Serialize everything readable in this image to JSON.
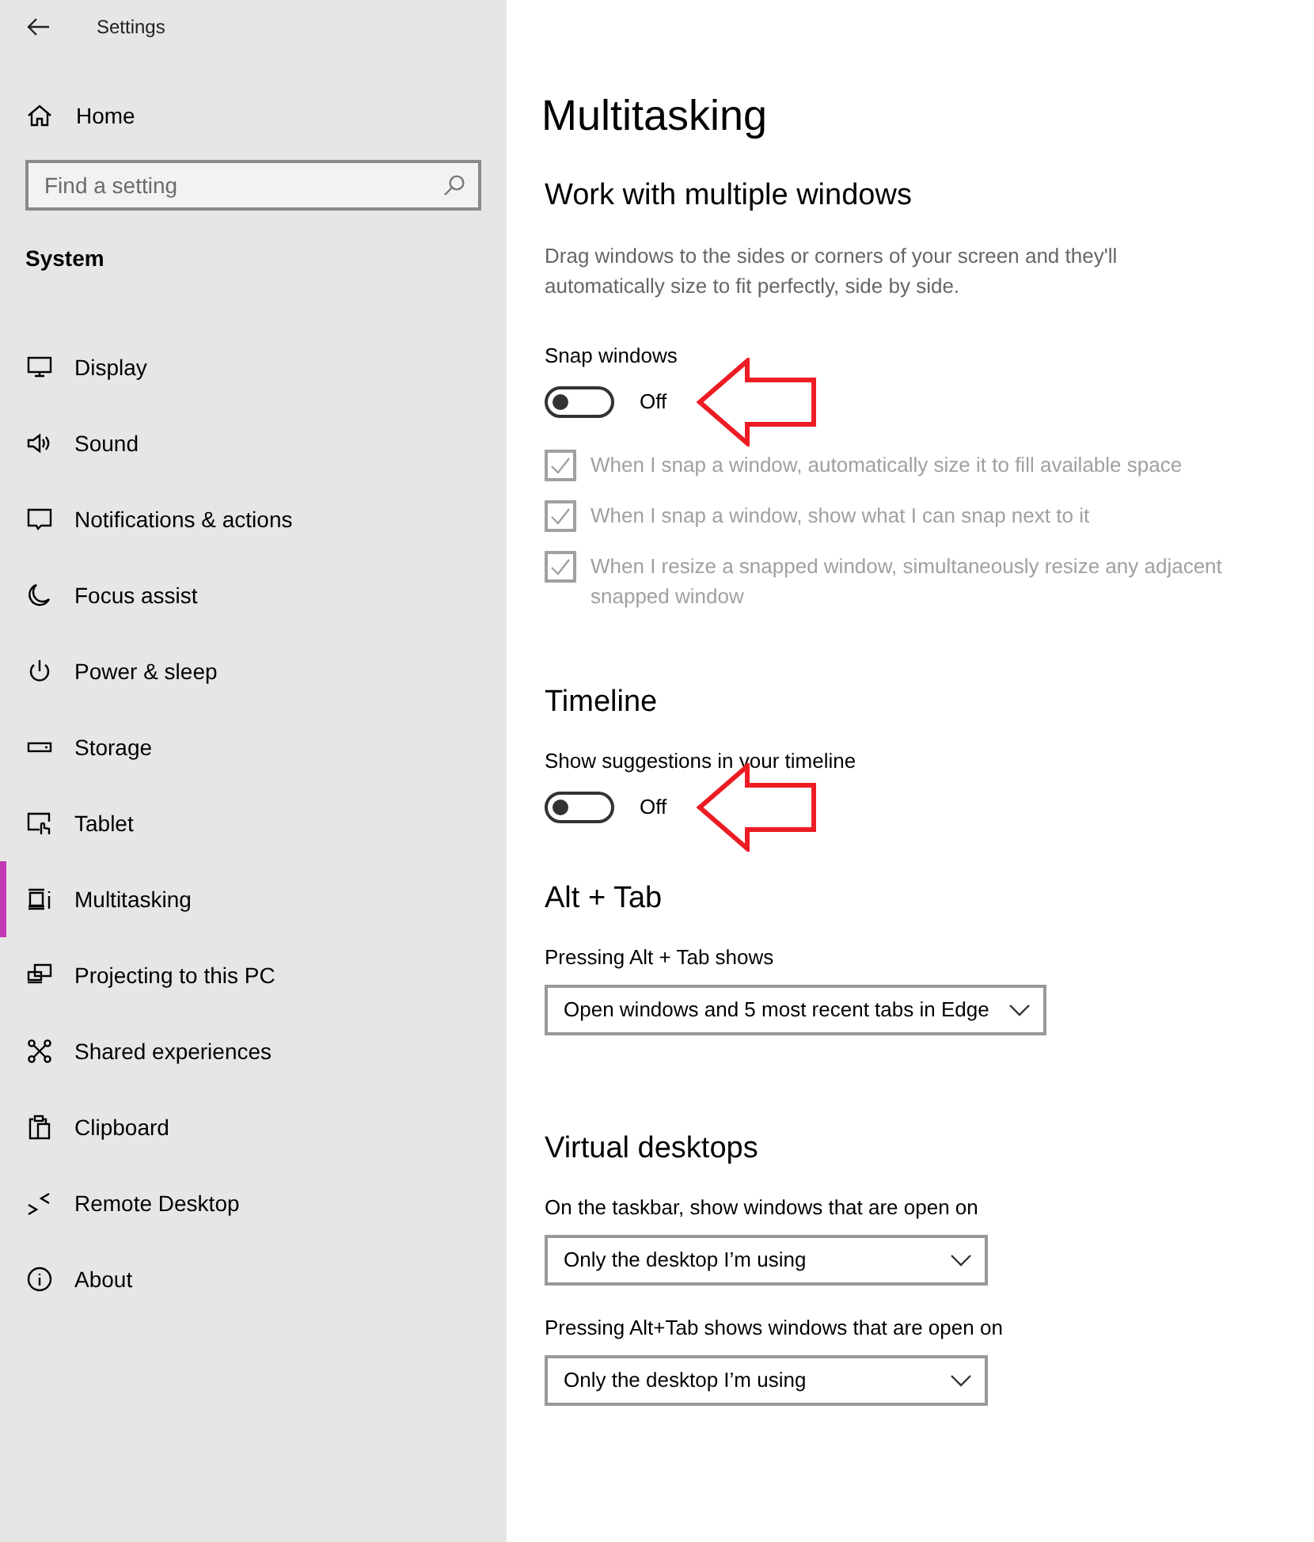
{
  "window": {
    "title": "Settings"
  },
  "sidebar": {
    "home": "Home",
    "search": {
      "placeholder": "Find a setting"
    },
    "section": "System",
    "items": [
      {
        "label": "Display",
        "selected": false
      },
      {
        "label": "Sound",
        "selected": false
      },
      {
        "label": "Notifications & actions",
        "selected": false
      },
      {
        "label": "Focus assist",
        "selected": false
      },
      {
        "label": "Power & sleep",
        "selected": false
      },
      {
        "label": "Storage",
        "selected": false
      },
      {
        "label": "Tablet",
        "selected": false
      },
      {
        "label": "Multitasking",
        "selected": true
      },
      {
        "label": "Projecting to this PC",
        "selected": false
      },
      {
        "label": "Shared experiences",
        "selected": false
      },
      {
        "label": "Clipboard",
        "selected": false
      },
      {
        "label": "Remote Desktop",
        "selected": false
      },
      {
        "label": "About",
        "selected": false
      }
    ]
  },
  "page": {
    "title": "Multitasking",
    "sections": [
      {
        "heading": "Work with multiple windows",
        "items": [
          {
            "kind": "text",
            "text": "Drag windows to the sides or corners of your screen and they'll automatically size to fit perfectly, side by side."
          },
          {
            "kind": "toggle",
            "label": "Snap windows",
            "on": false,
            "state": "Off"
          },
          {
            "kind": "checkbox",
            "label": "When I snap a window, automatically size it to fill available space",
            "checked": true,
            "disabled": true
          },
          {
            "kind": "checkbox",
            "label": "When I snap a window, show what I can snap next to it",
            "checked": true,
            "disabled": true
          },
          {
            "kind": "checkbox",
            "label": "When I resize a snapped window, simultaneously resize any adjacent snapped window",
            "checked": true,
            "disabled": true
          }
        ]
      },
      {
        "heading": "Timeline",
        "items": [
          {
            "kind": "toggle",
            "label": "Show suggestions in your timeline",
            "on": false,
            "state": "Off"
          }
        ]
      },
      {
        "heading": "Alt + Tab",
        "items": [
          {
            "kind": "dropdown",
            "label": "Pressing Alt + Tab shows",
            "value": "Open windows and 5 most recent tabs in Edge"
          }
        ]
      },
      {
        "heading": "Virtual desktops",
        "items": [
          {
            "kind": "dropdown",
            "label": "On the taskbar, show windows that are open on",
            "value": "Only the desktop I’m using"
          },
          {
            "kind": "dropdown",
            "label": "Pressing Alt+Tab shows windows that are open on",
            "value": "Only the desktop I’m using"
          }
        ]
      }
    ]
  }
}
